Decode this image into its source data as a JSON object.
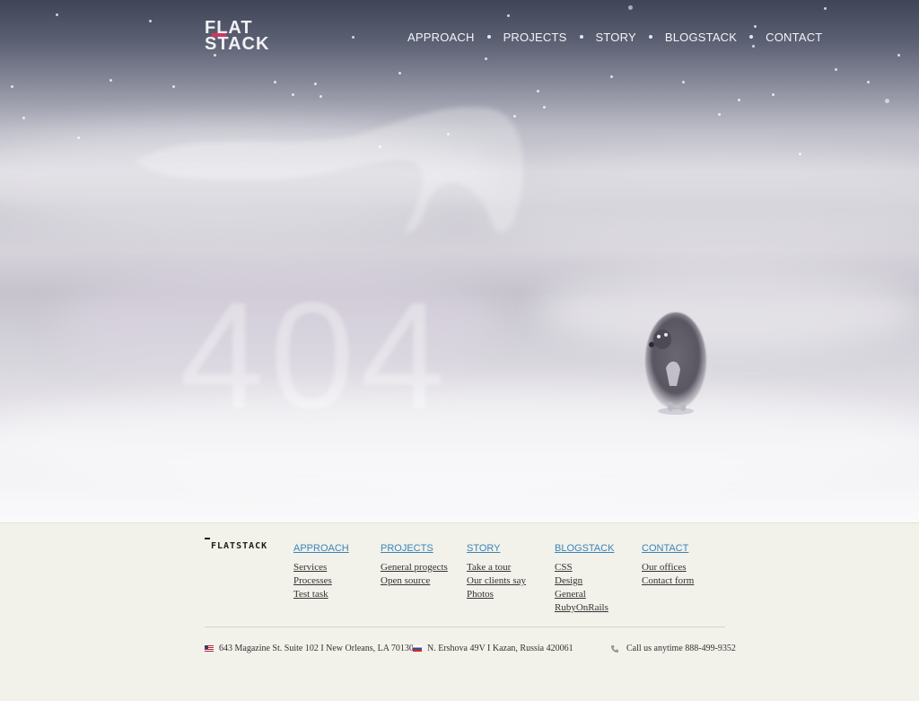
{
  "header": {
    "logo_line1": "FLAT",
    "logo_line2": "STACK",
    "nav": [
      "APPROACH",
      "PROJECTS",
      "STORY",
      "BLOGSTACK",
      "CONTACT"
    ]
  },
  "hero": {
    "error_code": "404"
  },
  "footer": {
    "logo": "FLATSTACK",
    "columns": [
      {
        "heading": "APPROACH",
        "items": [
          "Services",
          "Processes",
          "Test task"
        ]
      },
      {
        "heading": "PROJECTS",
        "items": [
          "General progects",
          "Open source"
        ]
      },
      {
        "heading": "STORY",
        "items": [
          "Take a tour",
          "Our clients say",
          "Photos"
        ]
      },
      {
        "heading": "BLOGSTACK",
        "items": [
          "CSS",
          "Design",
          "General",
          "RubyOnRails"
        ]
      },
      {
        "heading": "CONTACT",
        "items": [
          "Our offices",
          "Contact form"
        ]
      }
    ],
    "address_us": "643 Magazine St. Suite 102  I  New Orleans,  LA 70130",
    "address_ru": "N. Ershova 49V  I  Kazan, Russia 420061",
    "phone_text": "Call us anytime 888-499-9352"
  },
  "colors": {
    "accent_link": "#3a85b9",
    "logo_mark": "#d4365f"
  },
  "icons": {
    "phone": "phone-icon",
    "flag_us": "us-flag-icon",
    "flag_ru": "russia-flag-icon"
  }
}
